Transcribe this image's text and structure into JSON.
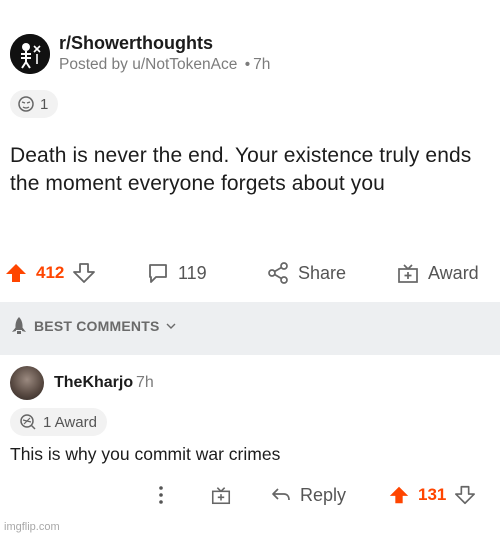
{
  "post": {
    "subreddit": "r/Showerthoughts",
    "posted_by_prefix": "Posted by",
    "username": "u/NotTokenAce",
    "separator": "•",
    "age": "7h",
    "award_count": "1",
    "title": "Death is never the end. Your existence truly ends the moment everyone forgets about you"
  },
  "actions": {
    "upvotes": "412",
    "comments": "119",
    "share_label": "Share",
    "award_label": "Award"
  },
  "sort": {
    "label": "BEST COMMENTS"
  },
  "comment": {
    "username": "TheKharjo",
    "age": "7h",
    "award_label": "1 Award",
    "body": "This is why you commit war crimes",
    "reply_label": "Reply",
    "upvotes": "131"
  },
  "watermark": "imgflip.com",
  "colors": {
    "upvote_accent": "#ff4500",
    "sort_band": "#edeff1",
    "muted_text": "#7c7c7c"
  },
  "icons": {
    "subreddit_avatar": "skeleton-icon",
    "upvote": "arrow-up-icon",
    "downvote": "arrow-down-icon",
    "comments": "speech-bubble-icon",
    "share": "share-icon",
    "award": "gift-icon",
    "sort": "rocket-icon",
    "more": "vertical-dots-icon",
    "reply": "reply-arrow-icon"
  }
}
